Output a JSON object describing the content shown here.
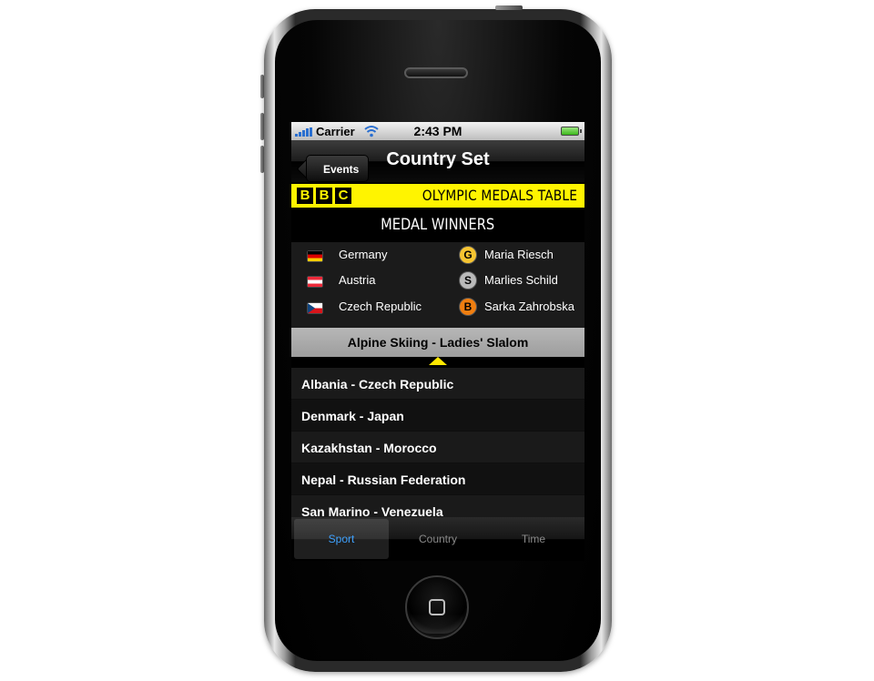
{
  "status_bar": {
    "carrier": "Carrier",
    "time": "2:43 PM"
  },
  "nav": {
    "back_label": "Events",
    "title": "Country Set"
  },
  "banner": {
    "logo": [
      "B",
      "B",
      "C"
    ],
    "title": "OLYMPIC MEDALS TABLE"
  },
  "medals": {
    "header": "MEDAL WINNERS",
    "rows": [
      {
        "country": "Germany",
        "medal": "G",
        "athlete": "Maria Riesch",
        "medal_color": "#f7c531",
        "flag": "germany-flag"
      },
      {
        "country": "Austria",
        "medal": "S",
        "athlete": "Marlies Schild",
        "medal_color": "#b9b9b9",
        "flag": "austria-flag"
      },
      {
        "country": "Czech Republic",
        "medal": "B",
        "athlete": "Sarka Zahrobska",
        "medal_color": "#f07e10",
        "flag": "czech-flag"
      }
    ]
  },
  "event": {
    "label": "Alpine Skiing - Ladies' Slalom"
  },
  "list": {
    "items": [
      "Albania - Czech Republic",
      "Denmark - Japan",
      "Kazakhstan - Morocco",
      "Nepal - Russian Federation",
      "San Marino - Venezuela"
    ]
  },
  "tabs": [
    {
      "label": "Sport",
      "active": true
    },
    {
      "label": "Country",
      "active": false
    },
    {
      "label": "Time",
      "active": false
    }
  ],
  "colors": {
    "banner_yellow": "#fff400",
    "tab_active": "#3fa2ff"
  }
}
